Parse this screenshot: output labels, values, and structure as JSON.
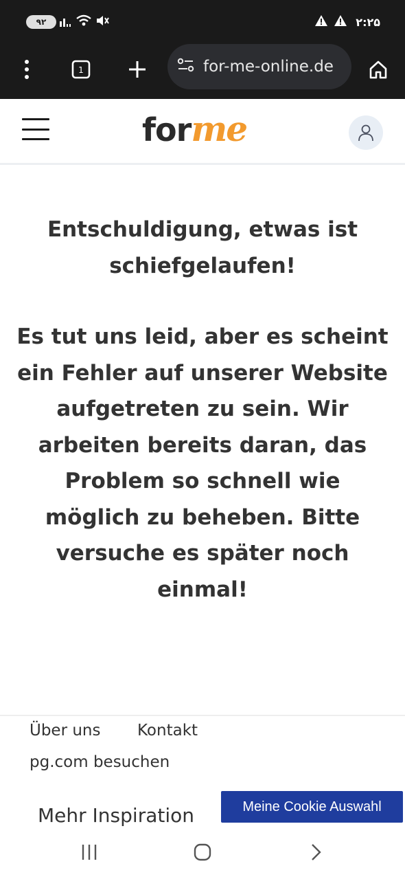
{
  "status_bar": {
    "battery": "۹۲",
    "clock": "۲:۲۵",
    "icons": [
      "battery-icon",
      "signal-icon",
      "wifi-icon",
      "mute-icon",
      "warning-icon",
      "warning-icon"
    ]
  },
  "browser": {
    "url": "for-me-online.de",
    "icons": [
      "more-vert-icon",
      "tab-switcher-icon",
      "new-tab-icon",
      "site-settings-icon",
      "home-icon"
    ]
  },
  "header": {
    "logo_for": "for",
    "logo_me": "me",
    "brand_color": "#f29a2e",
    "icons": [
      "hamburger-menu-icon",
      "user-icon"
    ]
  },
  "main": {
    "title": "Entschuldigung, etwas ist schiefgelaufen!",
    "message": "Es tut uns leid, aber es scheint ein Fehler auf unserer Website aufgetreten zu sein. Wir arbeiten bereits daran, das Problem so schnell wie möglich zu beheben. Bitte versuche es später noch einmal!"
  },
  "footer": {
    "links": [
      "Über uns",
      "Kontakt"
    ],
    "visit_link": "pg.com besuchen",
    "more": "Mehr Inspiration",
    "cookie_button": "Meine Cookie Auswahl",
    "cookie_color": "#1f3d9e"
  },
  "nav_bar": {
    "icons": [
      "recent-apps-icon",
      "home-button-icon",
      "back-icon"
    ]
  }
}
